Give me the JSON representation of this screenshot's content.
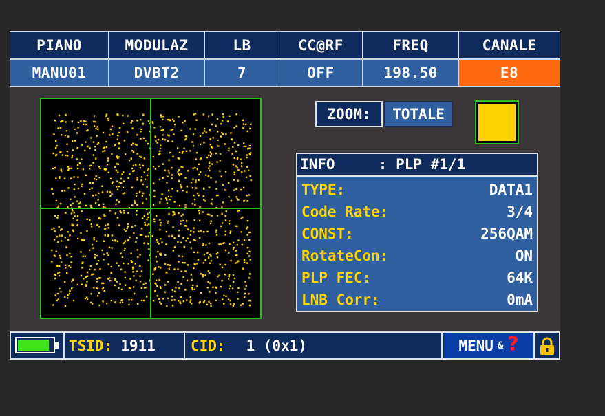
{
  "header": {
    "columns": [
      {
        "label": "PIANO",
        "value": "MANU01"
      },
      {
        "label": "MODULAZ",
        "value": "DVBT2"
      },
      {
        "label": "LB",
        "value": "7"
      },
      {
        "label": "CC@RF",
        "value": "OFF"
      },
      {
        "label": "FREQ",
        "value": "198.50"
      },
      {
        "label": "CANALE",
        "value": "E8"
      }
    ],
    "accent_color": "#ff6a10"
  },
  "zoom": {
    "label": "ZOOM:",
    "value": "TOTALE"
  },
  "symbol_color": "#ffd200",
  "info": {
    "title": "INFO     : PLP #1/1",
    "rows": [
      {
        "key": "TYPE:",
        "value": "DATA1"
      },
      {
        "key": "Code Rate:",
        "value": "3/4"
      },
      {
        "key": "CONST:",
        "value": "256QAM"
      },
      {
        "key": "RotateCon:",
        "value": "ON"
      },
      {
        "key": "PLP FEC:",
        "value": "64K"
      },
      {
        "key": "LNB Corr:",
        "value": "0mA"
      }
    ]
  },
  "status": {
    "tsid_label": "TSID:",
    "tsid_value": "1911",
    "cid_label": "CID:",
    "cid_value": "1 (0x1)",
    "menu_label": "MENU",
    "menu_amp": "&",
    "menu_q": "?",
    "battery_level": 0.9
  },
  "icons": {
    "battery": "battery-icon",
    "help": "help-icon",
    "lock": "lock-icon",
    "constellation": "constellation-diagram"
  }
}
